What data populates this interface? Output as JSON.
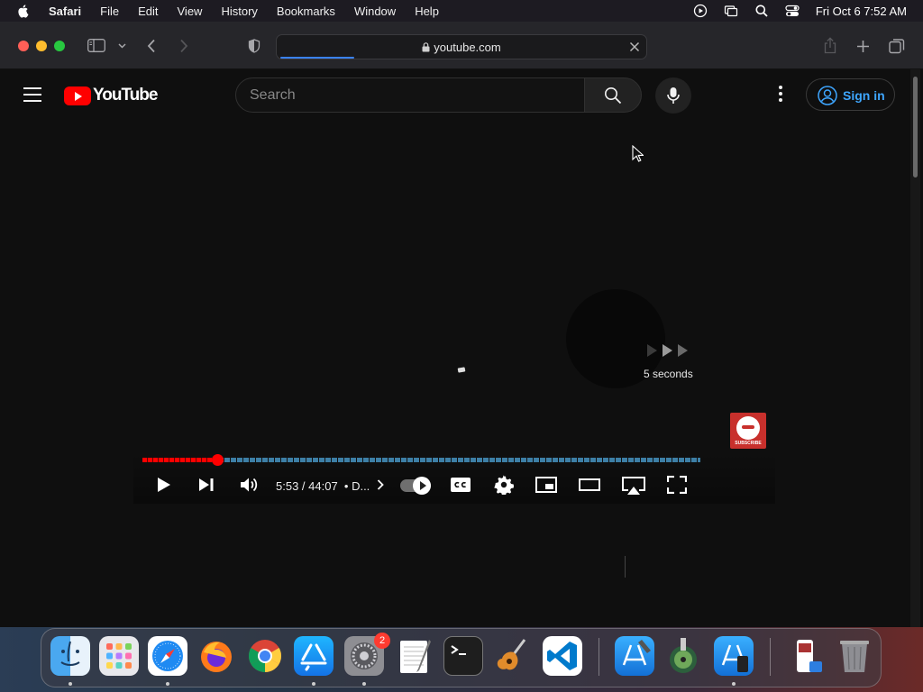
{
  "menubar": {
    "app_name": "Safari",
    "items": [
      "File",
      "Edit",
      "View",
      "History",
      "Bookmarks",
      "Window",
      "Help"
    ],
    "clock": "Fri Oct 6  7:52 AM"
  },
  "browser": {
    "url": "youtube.com",
    "load_progress": 0.2
  },
  "youtube": {
    "logo_text": "YouTube",
    "search_placeholder": "Search",
    "sign_in_label": "Sign in",
    "accent_color": "#3ea6ff",
    "brand_color": "#ff0000"
  },
  "player": {
    "skip_label": "5 seconds",
    "time_display": "5:53 / 44:07",
    "chapter_text": "• D...",
    "progress_fraction": 0.1337,
    "watermark_text": "SUBSCRIBE"
  },
  "dock": {
    "apps": [
      "Finder",
      "Launchpad",
      "Safari",
      "Firefox",
      "Chrome",
      "App Store",
      "System Settings",
      "TextEdit",
      "Terminal",
      "GarageBand",
      "Visual Studio Code",
      "Xcode",
      "Disk Utility",
      "Simulator",
      "Preview",
      "Trash"
    ],
    "settings_badge": "2"
  }
}
